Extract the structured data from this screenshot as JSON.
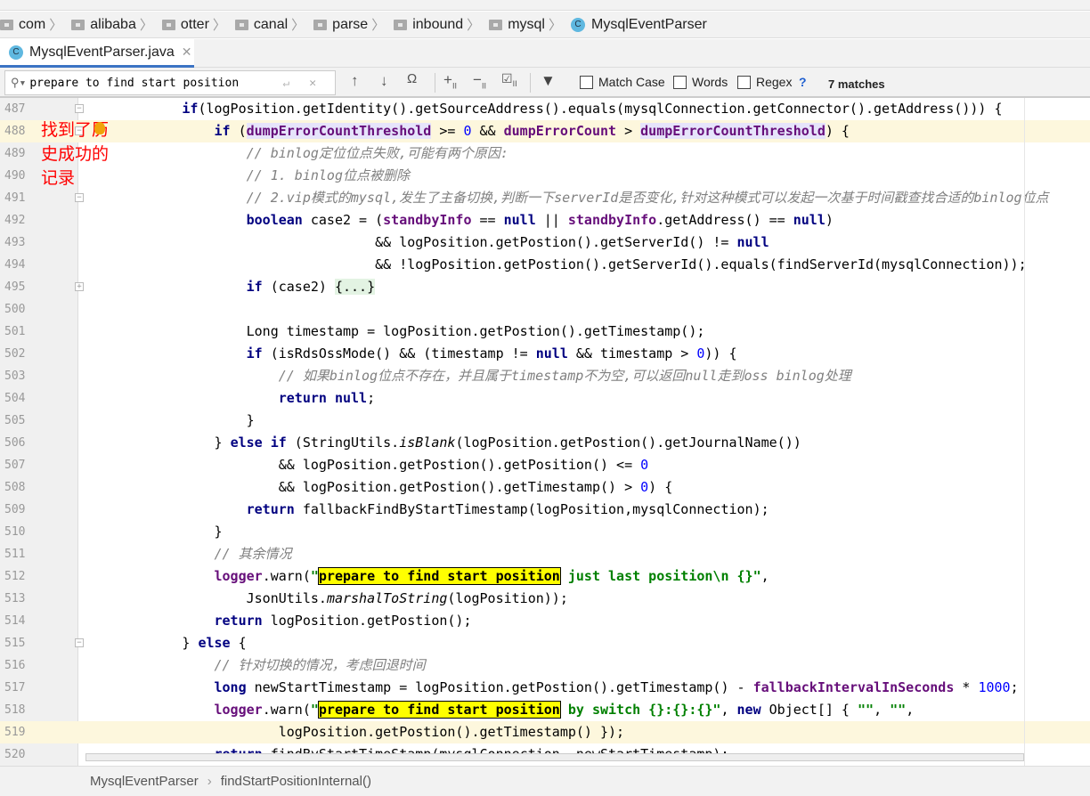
{
  "breadcrumb": [
    "com",
    "alibaba",
    "otter",
    "canal",
    "parse",
    "inbound",
    "mysql"
  ],
  "breadcrumb_class": "MysqlEventParser",
  "tab": {
    "label": "MysqlEventParser.java",
    "icon": "class-icon"
  },
  "find": {
    "query": "prepare to find start position",
    "match_case": "Match Case",
    "words": "Words",
    "regex": "Regex",
    "help": "?",
    "matches": "7 matches"
  },
  "annotation": "找到了历史成功的记录",
  "status": {
    "class": "MysqlEventParser",
    "method": "findStartPositionInternal()"
  },
  "colors": {
    "keyword": "#000080",
    "field": "#660e7a",
    "string": "#008000",
    "comment": "#808080",
    "number": "#0000ff",
    "search_highlight": "#ffff00",
    "annotation": "#ff0000"
  },
  "lines": [
    {
      "n": "487",
      "i": 12,
      "t": [
        [
          "kw",
          "if"
        ],
        [
          "",
          "(logPosition.getIdentity().getSourceAddress().equals(mysqlConnection.getConnector().getAddress())) {"
        ]
      ]
    },
    {
      "n": "488",
      "i": 16,
      "caret": true,
      "t": [
        [
          "kw",
          "if"
        ],
        [
          "",
          " ("
        ],
        [
          "fld ref",
          "dumpErrorCountThreshold"
        ],
        [
          "",
          " >= "
        ],
        [
          "num",
          "0"
        ],
        [
          "",
          " && "
        ],
        [
          "fld",
          "dumpErrorCount"
        ],
        [
          "",
          " > "
        ],
        [
          "fld ref",
          "dumpErrorCountThreshold"
        ],
        [
          "",
          ") {"
        ]
      ]
    },
    {
      "n": "489",
      "i": 20,
      "t": [
        [
          "cmt",
          "// binlog定位位点失败,可能有两个原因:"
        ]
      ]
    },
    {
      "n": "490",
      "i": 20,
      "t": [
        [
          "cmt",
          "// 1. binlog位点被删除"
        ]
      ]
    },
    {
      "n": "491",
      "i": 20,
      "t": [
        [
          "cmt",
          "// 2.vip模式的mysql,发生了主备切换,判断一下serverId是否变化,针对这种模式可以发起一次基于时间戳查找合适的binlog位点"
        ]
      ]
    },
    {
      "n": "492",
      "i": 20,
      "t": [
        [
          "kw",
          "boolean"
        ],
        [
          "",
          " case2 = ("
        ],
        [
          "fld",
          "standbyInfo"
        ],
        [
          "",
          " == "
        ],
        [
          "kw",
          "null"
        ],
        [
          "",
          " || "
        ],
        [
          "fld",
          "standbyInfo"
        ],
        [
          "",
          ".getAddress() == "
        ],
        [
          "kw",
          "null"
        ],
        [
          "",
          ")"
        ]
      ]
    },
    {
      "n": "493",
      "i": 36,
      "t": [
        [
          "",
          "&& logPosition.getPostion().getServerId() != "
        ],
        [
          "kw",
          "null"
        ]
      ]
    },
    {
      "n": "494",
      "i": 36,
      "t": [
        [
          "",
          "&& !logPosition.getPostion().getServerId().equals(findServerId(mysqlConnection));"
        ]
      ]
    },
    {
      "n": "495",
      "i": 20,
      "t": [
        [
          "kw",
          "if"
        ],
        [
          "",
          " (case2) "
        ],
        [
          "fold",
          "{...}"
        ]
      ]
    },
    {
      "n": "500",
      "i": 0,
      "t": []
    },
    {
      "n": "501",
      "i": 20,
      "t": [
        [
          "",
          "Long timestamp = logPosition.getPostion().getTimestamp();"
        ]
      ]
    },
    {
      "n": "502",
      "i": 20,
      "t": [
        [
          "kw",
          "if"
        ],
        [
          "",
          " (isRdsOssMode() && (timestamp != "
        ],
        [
          "kw",
          "null"
        ],
        [
          "",
          " && timestamp > "
        ],
        [
          "num",
          "0"
        ],
        [
          "",
          ")) {"
        ]
      ]
    },
    {
      "n": "503",
      "i": 24,
      "t": [
        [
          "cmt",
          "// 如果binlog位点不存在，并且属于timestamp不为空,可以返回null走到oss binlog处理"
        ]
      ]
    },
    {
      "n": "504",
      "i": 24,
      "t": [
        [
          "kw",
          "return null"
        ],
        [
          "",
          ";"
        ]
      ]
    },
    {
      "n": "505",
      "i": 20,
      "t": [
        [
          "",
          "}"
        ]
      ]
    },
    {
      "n": "506",
      "i": 16,
      "t": [
        [
          "",
          "} "
        ],
        [
          "kw",
          "else if"
        ],
        [
          "",
          " (StringUtils."
        ],
        [
          "it",
          "isBlank"
        ],
        [
          "",
          "(logPosition.getPostion().getJournalName())"
        ]
      ]
    },
    {
      "n": "507",
      "i": 24,
      "t": [
        [
          "",
          "&& logPosition.getPostion().getPosition() <= "
        ],
        [
          "num",
          "0"
        ]
      ]
    },
    {
      "n": "508",
      "i": 24,
      "t": [
        [
          "",
          "&& logPosition.getPostion().getTimestamp() > "
        ],
        [
          "num",
          "0"
        ],
        [
          "",
          ") {"
        ]
      ]
    },
    {
      "n": "509",
      "i": 20,
      "t": [
        [
          "kw",
          "return"
        ],
        [
          "",
          " fallbackFindByStartTimestamp(logPosition,mysqlConnection);"
        ]
      ]
    },
    {
      "n": "510",
      "i": 16,
      "t": [
        [
          "",
          "}"
        ]
      ]
    },
    {
      "n": "511",
      "i": 16,
      "t": [
        [
          "cmt",
          "// 其余情况"
        ]
      ]
    },
    {
      "n": "512",
      "i": 16,
      "t": [
        [
          "fld",
          "logger"
        ],
        [
          "",
          ".warn("
        ],
        [
          "str",
          "\""
        ],
        [
          "hl",
          "prepare to find start position"
        ],
        [
          "str",
          " just last position\\n {}\""
        ],
        [
          "",
          ","
        ]
      ]
    },
    {
      "n": "513",
      "i": 20,
      "t": [
        [
          "",
          "JsonUtils."
        ],
        [
          "it",
          "marshalToString"
        ],
        [
          "",
          "(logPosition));"
        ]
      ]
    },
    {
      "n": "514",
      "i": 16,
      "t": [
        [
          "kw",
          "return"
        ],
        [
          "",
          " logPosition.getPostion();"
        ]
      ]
    },
    {
      "n": "515",
      "i": 12,
      "t": [
        [
          "",
          "} "
        ],
        [
          "kw",
          "else"
        ],
        [
          "",
          " {"
        ]
      ]
    },
    {
      "n": "516",
      "i": 16,
      "t": [
        [
          "cmt",
          "// 针对切换的情况，考虑回退时间"
        ]
      ]
    },
    {
      "n": "517",
      "i": 16,
      "t": [
        [
          "kw",
          "long"
        ],
        [
          "",
          " newStartTimestamp = logPosition.getPostion().getTimestamp() - "
        ],
        [
          "fld",
          "fallbackIntervalInSeconds"
        ],
        [
          "",
          " * "
        ],
        [
          "num",
          "1000"
        ],
        [
          "",
          ";"
        ]
      ]
    },
    {
      "n": "518",
      "i": 16,
      "t": [
        [
          "fld",
          "logger"
        ],
        [
          "",
          ".warn("
        ],
        [
          "str",
          "\""
        ],
        [
          "hl",
          "prepare to find start position"
        ],
        [
          "str",
          " by switch {}:{}:{}\""
        ],
        [
          "",
          ", "
        ],
        [
          "kw",
          "new"
        ],
        [
          "",
          " Object[] { "
        ],
        [
          "str",
          "\"\""
        ],
        [
          "",
          ", "
        ],
        [
          "str",
          "\"\""
        ],
        [
          "",
          ","
        ]
      ]
    },
    {
      "n": "519",
      "i": 24,
      "caret": true,
      "t": [
        [
          "",
          "logPosition.getPostion().getTimestamp() });"
        ]
      ]
    },
    {
      "n": "520",
      "i": 16,
      "t": [
        [
          "kw",
          "return"
        ],
        [
          "",
          " findByStartTimeStamp(mysqlConnection, newStartTimestamp);"
        ]
      ]
    }
  ]
}
